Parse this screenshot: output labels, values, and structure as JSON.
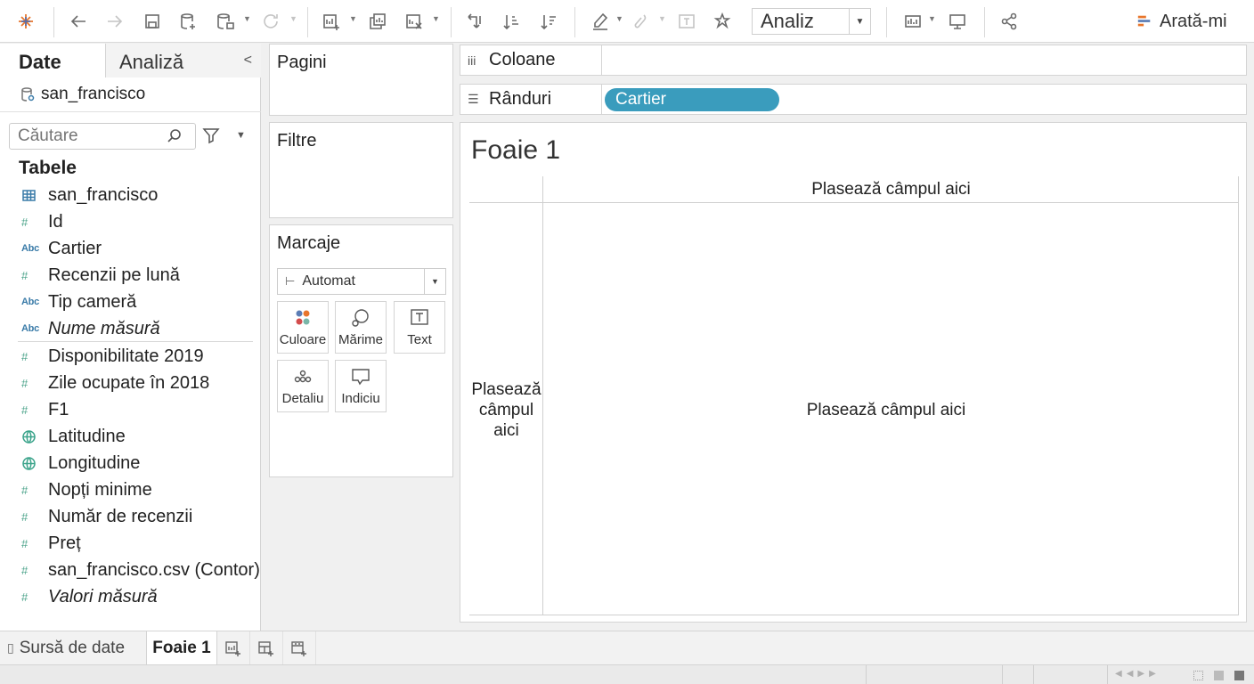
{
  "toolbar": {
    "analysis_select": "Analiz",
    "show_me": "Arată-mi",
    "icons": [
      "tableau-logo-icon",
      "undo-icon",
      "redo-icon",
      "save-icon",
      "new-datasource-icon",
      "pause-updates-icon",
      "refresh-icon",
      "new-worksheet-icon",
      "duplicate-icon",
      "clear-icon",
      "swap-icon",
      "sort-ascending-icon",
      "sort-descending-icon",
      "highlight-icon",
      "group-icon",
      "label-icon",
      "fix-axes-icon",
      "fit-icon",
      "presentation-icon",
      "share-icon"
    ]
  },
  "data_panel": {
    "tab_data": "Date",
    "tab_analysis": "Analiză",
    "datasource": "san_francisco",
    "search_placeholder": "Căutare",
    "tables_header": "Tabele",
    "dimensions": [
      {
        "label": "san_francisco",
        "type": "table"
      },
      {
        "label": "Id",
        "type": "number"
      },
      {
        "label": "Cartier",
        "type": "string"
      },
      {
        "label": "Recenzii pe lună",
        "type": "number"
      },
      {
        "label": "Tip cameră",
        "type": "string"
      },
      {
        "label": "Nume măsură",
        "type": "string",
        "italic": true
      }
    ],
    "measures": [
      {
        "label": "Disponibilitate 2019",
        "type": "number"
      },
      {
        "label": "Zile ocupate în 2018",
        "type": "number"
      },
      {
        "label": "F1",
        "type": "number"
      },
      {
        "label": "Latitudine",
        "type": "geo"
      },
      {
        "label": "Longitudine",
        "type": "geo"
      },
      {
        "label": "Nopți minime",
        "type": "number"
      },
      {
        "label": "Număr de recenzii",
        "type": "number"
      },
      {
        "label": "Preț",
        "type": "number"
      },
      {
        "label": "san_francisco.csv (Contor)",
        "type": "number"
      },
      {
        "label": "Valori măsură",
        "type": "number",
        "italic": true
      }
    ]
  },
  "cards": {
    "pages": "Pagini",
    "filters": "Filtre",
    "marks": "Marcaje",
    "marks_type": "Automat",
    "mark_buttons": [
      "Culoare",
      "Mărime",
      "Text",
      "Detaliu",
      "Indiciu"
    ]
  },
  "shelves": {
    "columns": "Coloane",
    "rows": "Rânduri",
    "rows_pill": "Cartier",
    "pill_color": "#3a9cbd"
  },
  "view": {
    "title": "Foaie 1",
    "drop_top": "Plasează câmpul aici",
    "drop_left": "Plasează câmpul aici",
    "drop_main": "Plasează câmpul aici"
  },
  "tabbar": {
    "source_tab": "Sursă de date",
    "active_tab": "Foaie 1"
  }
}
